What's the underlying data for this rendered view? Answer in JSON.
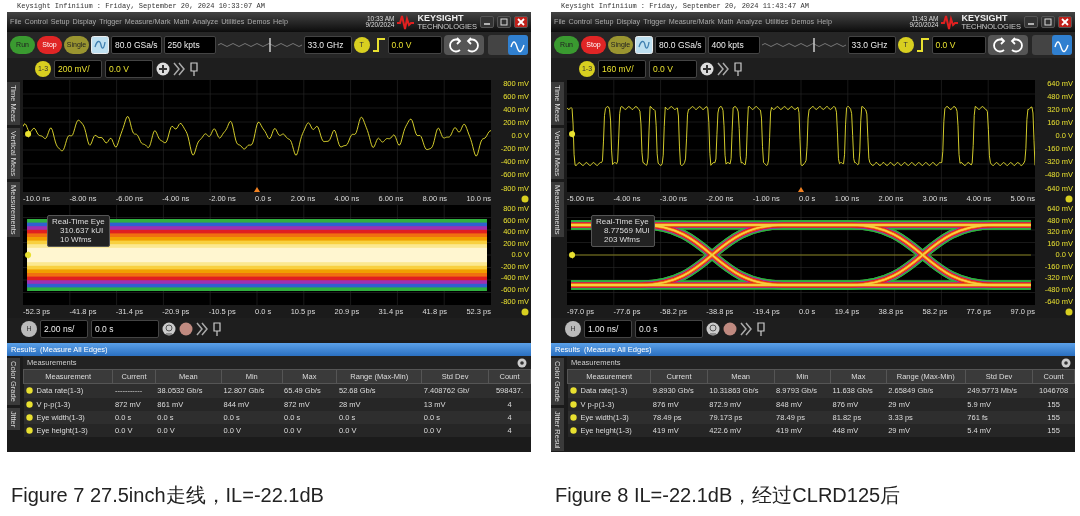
{
  "figures": [
    {
      "timestamp": "Keysight Infiniium : Friday, September 20, 2024 10:33:07 AM",
      "menu": [
        "File",
        "Control",
        "Setup",
        "Display",
        "Trigger",
        "Measure/Mark",
        "Math",
        "Analyze",
        "Utilities",
        "Demos",
        "Help"
      ],
      "clock_time": "10:33 AM",
      "clock_date": "9/20/2024",
      "brand": "KEYSIGHT",
      "brand_sub": "TECHNOLOGIES",
      "run_buttons": [
        {
          "label": "Run",
          "kind": "run"
        },
        {
          "label": "Stop",
          "kind": "stop"
        },
        {
          "label": "Single",
          "kind": "single"
        }
      ],
      "sample_rate": "80.0 GSa/s",
      "memory_depth": "250 kpts",
      "bandwidth": "33.0 GHz",
      "trigger_badge": "T",
      "trigger_level": "0.0 V",
      "channel_badge": "1-3",
      "channel_scale": "200 mV/",
      "channel_offset": "0.0 V",
      "side_tabs": [
        "Time Meas",
        "Vertical Meas",
        "Measurements"
      ],
      "waveform": {
        "kind": "analog",
        "y_labels": [
          "800 mV",
          "600 mV",
          "400 mV",
          "200 mV",
          "0.0 V",
          "-200 mV",
          "-400 mV",
          "-600 mV",
          "-800 mV"
        ],
        "x_labels": [
          "-10.0 ns",
          "-8.00 ns",
          "-6.00 ns",
          "-4.00 ns",
          "-2.00 ns",
          "0.0 s",
          "2.00 ns",
          "4.00 ns",
          "6.00 ns",
          "8.00 ns",
          "10.0 ns"
        ]
      },
      "eye": {
        "kind": "closed",
        "title": "Real-Time Eye",
        "ui_count": "310.637 kUI",
        "waveforms": "10 Wfms",
        "y_labels": [
          "800 mV",
          "600 mV",
          "400 mV",
          "200 mV",
          "0.0 V",
          "-200 mV",
          "-400 mV",
          "-600 mV",
          "-800 mV"
        ],
        "x_labels": [
          "-52.3 ps",
          "-41.8 ps",
          "-31.4 ps",
          "-20.9 ps",
          "-10.5 ps",
          "0.0 s",
          "10.5 ps",
          "20.9 ps",
          "31.4 ps",
          "41.8 ps",
          "52.3 ps"
        ]
      },
      "horizontal_badge": "H",
      "time_scale": "2.00 ns/",
      "time_offset": "0.0 s",
      "results_title": "Results",
      "results_subtitle": "(Measure All Edges)",
      "measurements_title": "Measurements",
      "result_tabs": [
        "Color Grade",
        "Jitter"
      ],
      "columns": [
        "Measurement",
        "Current",
        "Mean",
        "Min",
        "Max",
        "Range (Max-Min)",
        "Std Dev",
        "Count"
      ],
      "rows": [
        {
          "cells": [
            "Data rate(1-3)",
            "-----------",
            "38.0532 Gb/s",
            "12.807 Gb/s",
            "65.49 Gb/s",
            "52.68 Gb/s",
            "7.408762 Gb/",
            "598437."
          ]
        },
        {
          "cells": [
            "V p-p(1-3)",
            "872 mV",
            "861 mV",
            "844 mV",
            "872 mV",
            "28 mV",
            "13 mV",
            "4"
          ]
        },
        {
          "cells": [
            "Eye width(1-3)",
            "0.0 s",
            "0.0 s",
            "0.0 s",
            "0.0 s",
            "0.0 s",
            "0.0 s",
            "4"
          ]
        },
        {
          "cells": [
            "Eye height(1-3)",
            "0.0 V",
            "0.0 V",
            "0.0 V",
            "0.0 V",
            "0.0 V",
            "0.0 V",
            "4"
          ]
        }
      ],
      "caption": "Figure 7 27.5inch走线，IL=-22.1dB"
    },
    {
      "timestamp": "Keysight Infiniium : Friday, September 20, 2024 11:43:47 AM",
      "menu": [
        "File",
        "Control",
        "Setup",
        "Display",
        "Trigger",
        "Measure/Mark",
        "Math",
        "Analyze",
        "Utilities",
        "Demos",
        "Help"
      ],
      "clock_time": "11:43 AM",
      "clock_date": "9/20/2024",
      "brand": "KEYSIGHT",
      "brand_sub": "TECHNOLOGIES",
      "run_buttons": [
        {
          "label": "Run",
          "kind": "run"
        },
        {
          "label": "Stop",
          "kind": "stop"
        },
        {
          "label": "Single",
          "kind": "single"
        }
      ],
      "sample_rate": "80.0 GSa/s",
      "memory_depth": "400 kpts",
      "bandwidth": "33.0 GHz",
      "trigger_badge": "T",
      "trigger_level": "0.0 V",
      "channel_badge": "1-3",
      "channel_scale": "160 mV/",
      "channel_offset": "0.0 V",
      "side_tabs": [
        "Time Meas",
        "Vertical Meas",
        "Measurements"
      ],
      "waveform": {
        "kind": "nrz",
        "y_labels": [
          "640 mV",
          "480 mV",
          "320 mV",
          "160 mV",
          "0.0 V",
          "-160 mV",
          "-320 mV",
          "-480 mV",
          "-640 mV"
        ],
        "x_labels": [
          "-5.00 ns",
          "-4.00 ns",
          "-3.00 ns",
          "-2.00 ns",
          "-1.00 ns",
          "0.0 s",
          "1.00 ns",
          "2.00 ns",
          "3.00 ns",
          "4.00 ns",
          "5.00 ns"
        ]
      },
      "eye": {
        "kind": "open",
        "title": "Real-Time Eye",
        "ui_count": "8.77569 MUI",
        "waveforms": "203 Wfms",
        "y_labels": [
          "640 mV",
          "480 mV",
          "320 mV",
          "160 mV",
          "0.0 V",
          "-160 mV",
          "-320 mV",
          "-480 mV",
          "-640 mV"
        ],
        "x_labels": [
          "-97.0 ps",
          "-77.6 ps",
          "-58.2 ps",
          "-38.8 ps",
          "-19.4 ps",
          "0.0 s",
          "19.4 ps",
          "38.8 ps",
          "58.2 ps",
          "77.6 ps",
          "97.0 ps"
        ]
      },
      "horizontal_badge": "H",
      "time_scale": "1.00 ns/",
      "time_offset": "0.0 s",
      "results_title": "Results",
      "results_subtitle": "(Measure All Edges)",
      "measurements_title": "Measurements",
      "result_tabs": [
        "Color Grade",
        "Jitter Resul"
      ],
      "columns": [
        "Measurement",
        "Current",
        "Mean",
        "Min",
        "Max",
        "Range (Max-Min)",
        "Std Dev",
        "Count"
      ],
      "rows": [
        {
          "cells": [
            "Data rate(1-3)",
            "9.8930 Gb/s",
            "10.31863 Gb/s",
            "8.9793 Gb/s",
            "11.638 Gb/s",
            "2.65849 Gb/s",
            "249.5773 Mb/s",
            "1046708"
          ]
        },
        {
          "cells": [
            "V p-p(1-3)",
            "876 mV",
            "872.9 mV",
            "848 mV",
            "876 mV",
            "29 mV",
            "5.9 mV",
            "155"
          ]
        },
        {
          "cells": [
            "Eye width(1-3)",
            "78.49 ps",
            "79.173 ps",
            "78.49 ps",
            "81.82 ps",
            "3.33 ps",
            "761 fs",
            "155"
          ]
        },
        {
          "cells": [
            "Eye height(1-3)",
            "419 mV",
            "422.6 mV",
            "419 mV",
            "448 mV",
            "29 mV",
            "5.4 mV",
            "155"
          ]
        }
      ],
      "caption": "Figure 8 IL=-22.1dB，经过CLRD125后"
    }
  ]
}
